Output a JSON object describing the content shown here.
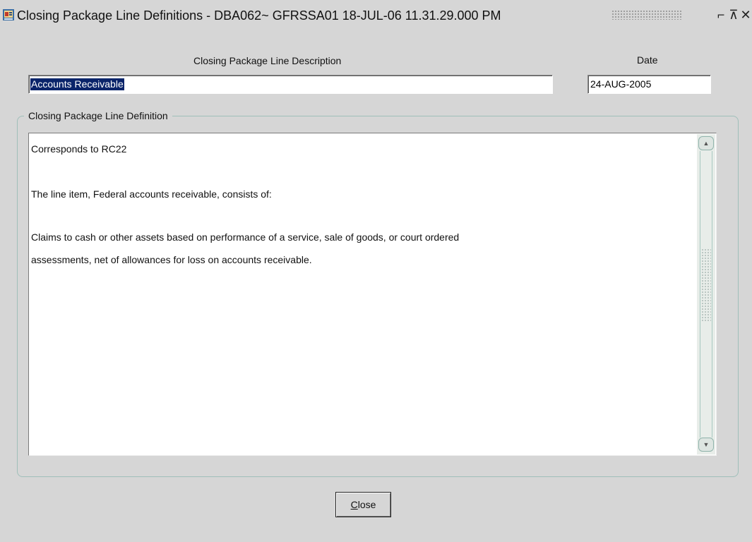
{
  "window": {
    "title": "Closing Package Line Definitions - DBA062~ GFRSSA01  18-JUL-06 11.31.29.000 PM",
    "minimize_glyph": "⌐",
    "maximize_glyph": "⊼",
    "close_glyph": "✕",
    "app_icon": "oracle-forms-icon"
  },
  "form": {
    "description_label": "Closing Package Line Description",
    "description_value": "Accounts Receivable",
    "date_label": "Date",
    "date_value": "24-AUG-2005",
    "definition_group_label": "Closing Package Line Definition",
    "definition_lines": [
      "Corresponds to RC22",
      "The line item, Federal accounts receivable, consists of:",
      "Claims to cash or other assets based on performance of a service, sale of goods, or court ordered",
      "assessments, net of allowances for loss on accounts receivable."
    ]
  },
  "buttons": {
    "close_mnemonic": "C",
    "close_rest": "lose"
  },
  "colors": {
    "background": "#d6d6d6",
    "selection": "#0a246a",
    "group_border": "#9fbfb9"
  }
}
